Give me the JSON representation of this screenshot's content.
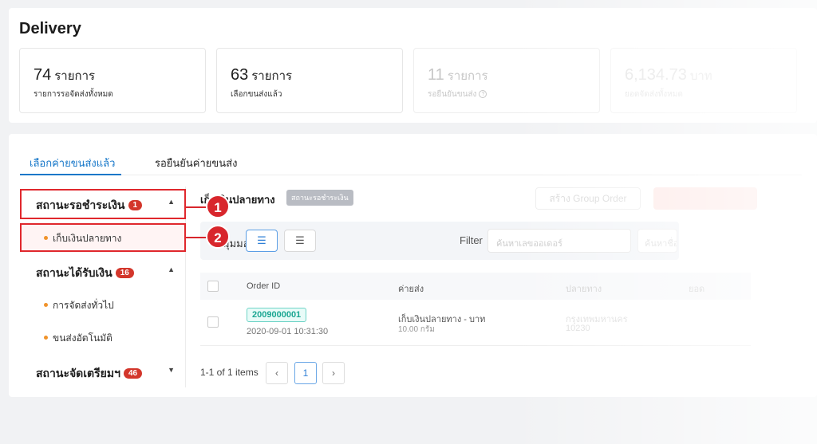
{
  "page": {
    "title": "Delivery"
  },
  "stats": [
    {
      "number": "74",
      "unit": "รายการ",
      "label": "รายการรอจัดส่งทั้งหมด"
    },
    {
      "number": "63",
      "unit": "รายการ",
      "label": "เลือกขนส่งแล้ว"
    },
    {
      "number": "11",
      "unit": "รายการ",
      "label": "รอยืนยันขนส่ง",
      "help_icon": "question-circle-icon"
    },
    {
      "number": "6,134.73",
      "unit": "บาท",
      "label": "ยอดจัดส่งทั้งหมด"
    }
  ],
  "tabs": [
    {
      "label": "เลือกค่ายขนส่งแล้ว",
      "active": true
    },
    {
      "label": "รอยืนยันค่ายขนส่ง",
      "active": false
    }
  ],
  "sidebar": {
    "groups": [
      {
        "label": "สถานะรอชำระเงิน",
        "badge": "1",
        "chevron": "chevron-up-icon",
        "items": [
          {
            "label": "เก็บเงินปลายทาง",
            "selected": true
          }
        ]
      },
      {
        "label": "สถานะได้รับเงิน",
        "badge": "16",
        "chevron": "chevron-up-icon",
        "items": [
          {
            "label": "การจัดส่งทั่วไป"
          },
          {
            "label": "ขนส่งอัตโนมัติ"
          }
        ]
      },
      {
        "label": "สถานะจัดเตรียมฯ",
        "badge": "46",
        "chevron": "chevron-down-icon",
        "items": []
      }
    ]
  },
  "callouts": [
    "1",
    "2"
  ],
  "content": {
    "title": "เก็บเงินปลายทาง",
    "status_chip": "สถานะรอชำระเงิน",
    "create_group_button": "สร้าง Group Order",
    "filter_bar": {
      "view_label": "มุมมอง",
      "filter_label": "Filter",
      "search_placeholder": "ค้นหาเลขออเดอร์",
      "secondary_placeholder": "ค้นหาชื่อลูกค้า"
    },
    "table": {
      "headers": [
        "Order ID",
        "ค่ายส่ง",
        "ปลายทาง",
        "ยอด"
      ],
      "rows": [
        {
          "order_id": "2009000001",
          "date": "2020-09-01 10:31:30",
          "shipping": "เก็บเงินปลายทาง - บาท",
          "weight": "10.00 กรัม",
          "dest_line1": "กรุงเทพมหานคร",
          "dest_line2": "10230",
          "extra1": "",
          "extra2": ""
        }
      ]
    },
    "pagination": {
      "summary": "1-1 of 1 items",
      "current_page": "1",
      "prev": "‹",
      "next": "›"
    }
  }
}
